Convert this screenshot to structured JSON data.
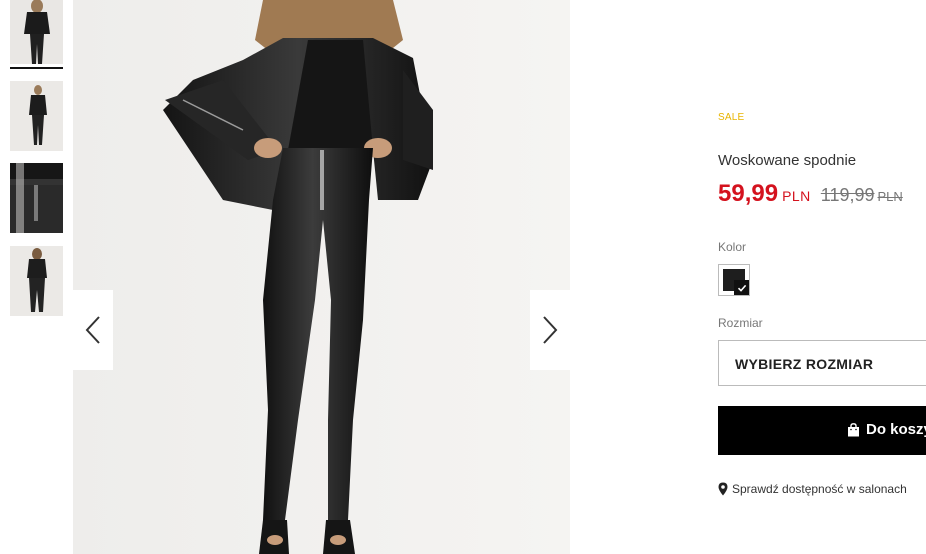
{
  "gallery": {
    "thumbnails": [
      {
        "alt": "model-front-full"
      },
      {
        "alt": "model-side-full"
      },
      {
        "alt": "waist-detail"
      },
      {
        "alt": "model-back-full"
      }
    ],
    "prev_icon": "chevron-left-icon",
    "next_icon": "chevron-right-icon"
  },
  "product": {
    "badge": "SALE",
    "name": "Woskowane spodnie",
    "price_new": "59,99",
    "price_new_currency": "PLN",
    "price_old": "119,99",
    "price_old_currency": "PLN",
    "color_label": "Kolor",
    "color_swatch": "#1e1e1e",
    "size_label": "Rozmiar",
    "size_select": "WYBIERZ ROZMIAR",
    "cart_button": "Do koszyka",
    "store_link": "Sprawdź dostępność w salonach"
  },
  "colors": {
    "sale": "#e8b400",
    "price": "#d4121e",
    "cart_bg": "#000000"
  }
}
